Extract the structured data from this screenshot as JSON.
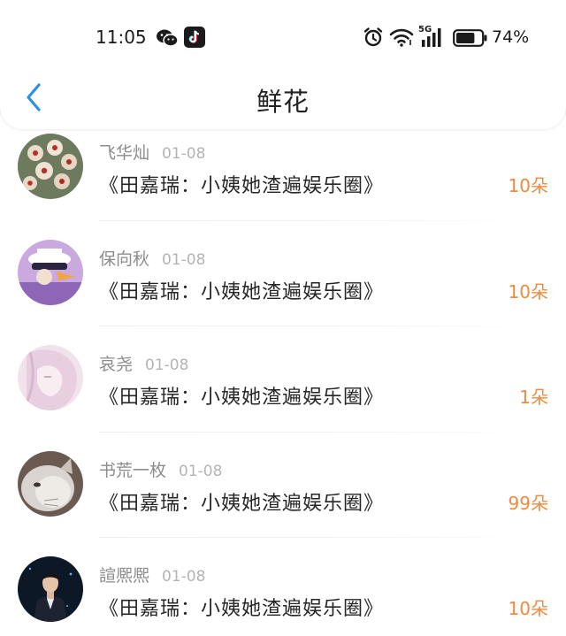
{
  "status_bar": {
    "time": "11:05",
    "network": "5G",
    "battery_percent": "74%",
    "left_icons": [
      "wechat-icon",
      "tiktok-icon"
    ],
    "right_icons": [
      "alarm-icon",
      "wifi-icon",
      "signal-icon",
      "battery-icon"
    ],
    "battery_level": 0.74
  },
  "nav": {
    "title": "鲜花",
    "back_icon": "chevron-left-icon",
    "accent_color": "#2e8fe8"
  },
  "colors": {
    "amount": "#f08a3e",
    "username": "#8c8c8c",
    "date": "#b4b4b4"
  },
  "gifts": [
    {
      "user": "飞华灿",
      "date": "01-08",
      "book": "《田嘉瑞：小姨她渣遍娱乐圈》",
      "amount": "10朵"
    },
    {
      "user": "保向秋",
      "date": "01-08",
      "book": "《田嘉瑞：小姨她渣遍娱乐圈》",
      "amount": "10朵"
    },
    {
      "user": "哀尧",
      "date": "01-08",
      "book": "《田嘉瑞：小姨她渣遍娱乐圈》",
      "amount": "1朵"
    },
    {
      "user": "书荒一枚",
      "date": "01-08",
      "book": "《田嘉瑞：小姨她渣遍娱乐圈》",
      "amount": "99朵"
    },
    {
      "user": "諠熈熈",
      "date": "01-08",
      "book": "《田嘉瑞：小姨她渣遍娱乐圈》",
      "amount": "10朵"
    }
  ]
}
